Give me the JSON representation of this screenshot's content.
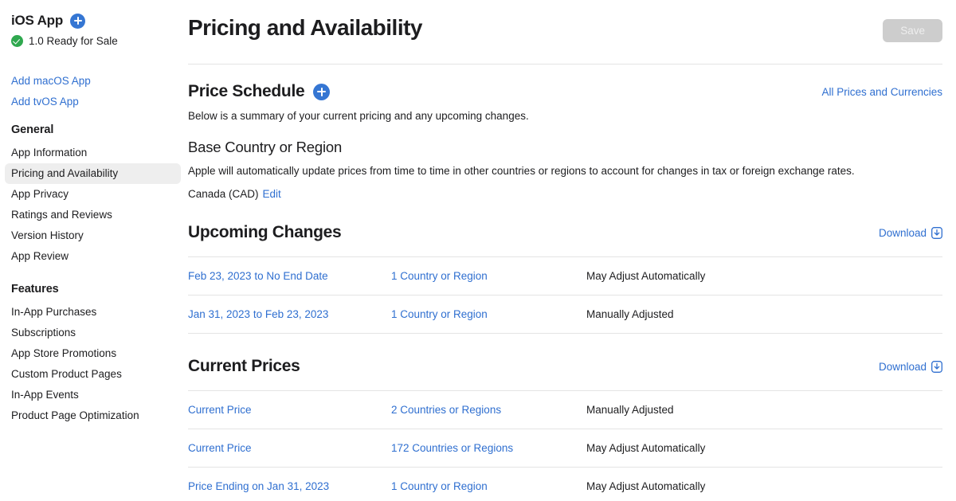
{
  "sidebar": {
    "app": {
      "title": "iOS App",
      "add_icon": "plus-circle-icon",
      "status_icon": "check-circle-icon",
      "status": "1.0 Ready for Sale"
    },
    "platform_links": [
      {
        "label": "Add macOS App"
      },
      {
        "label": "Add tvOS App"
      }
    ],
    "groups": [
      {
        "title": "General",
        "items": [
          {
            "label": "App Information",
            "active": false
          },
          {
            "label": "Pricing and Availability",
            "active": true
          },
          {
            "label": "App Privacy",
            "active": false
          },
          {
            "label": "Ratings and Reviews",
            "active": false
          },
          {
            "label": "Version History",
            "active": false
          },
          {
            "label": "App Review",
            "active": false
          }
        ]
      },
      {
        "title": "Features",
        "items": [
          {
            "label": "In-App Purchases",
            "active": false
          },
          {
            "label": "Subscriptions",
            "active": false
          },
          {
            "label": "App Store Promotions",
            "active": false
          },
          {
            "label": "Custom Product Pages",
            "active": false
          },
          {
            "label": "In-App Events",
            "active": false
          },
          {
            "label": "Product Page Optimization",
            "active": false
          }
        ]
      }
    ]
  },
  "header": {
    "title": "Pricing and Availability",
    "save_label": "Save"
  },
  "price_schedule": {
    "title": "Price Schedule",
    "add_icon": "plus-circle-icon",
    "all_prices_link": "All Prices and Currencies",
    "summary": "Below is a summary of your current pricing and any upcoming changes.",
    "base_region": {
      "title": "Base Country or Region",
      "description": "Apple will automatically update prices from time to time in other countries or regions to account for changes in tax or foreign exchange rates.",
      "value": "Canada (CAD)",
      "edit_label": "Edit"
    }
  },
  "upcoming_changes": {
    "title": "Upcoming Changes",
    "download_label": "Download",
    "download_icon": "download-box-icon",
    "rows": [
      {
        "period": "Feb 23, 2023 to No End Date",
        "regions": "1 Country or Region",
        "adjustment": "May Adjust Automatically"
      },
      {
        "period": "Jan 31, 2023 to Feb 23, 2023",
        "regions": "1 Country or Region",
        "adjustment": "Manually Adjusted"
      }
    ]
  },
  "current_prices": {
    "title": "Current Prices",
    "download_label": "Download",
    "download_icon": "download-box-icon",
    "rows": [
      {
        "period": "Current Price",
        "regions": "2 Countries or Regions",
        "adjustment": "Manually Adjusted"
      },
      {
        "period": "Current Price",
        "regions": "172 Countries or Regions",
        "adjustment": "May Adjust Automatically"
      },
      {
        "period": "Price Ending on Jan 31, 2023",
        "regions": "1 Country or Region",
        "adjustment": "May Adjust Automatically"
      }
    ]
  },
  "colors": {
    "link": "#2f6fd0",
    "accent": "#3576d3",
    "status_green": "#2fa84f",
    "divider": "#e4e4e4",
    "active_row": "#eeeeee",
    "save_disabled_bg": "#cdcdcd"
  }
}
